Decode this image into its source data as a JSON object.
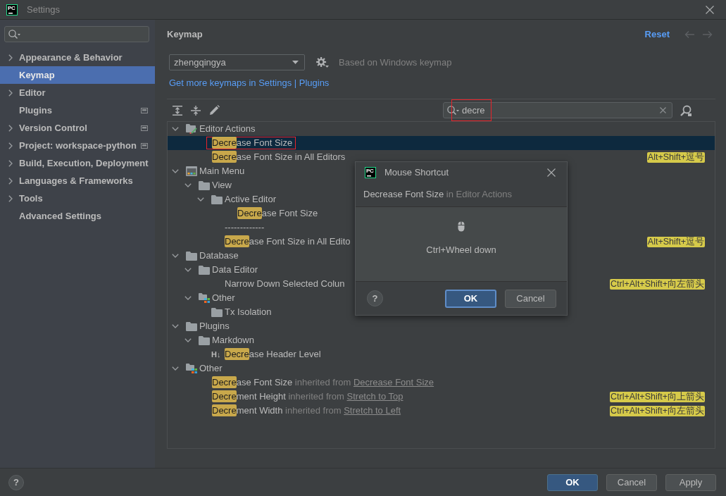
{
  "window": {
    "logo": "PC",
    "title": "Settings"
  },
  "sidebar": {
    "items": [
      {
        "label": "Appearance & Behavior",
        "expandable": true,
        "project_level": false,
        "selected": false
      },
      {
        "label": "Keymap",
        "expandable": false,
        "project_level": false,
        "selected": true
      },
      {
        "label": "Editor",
        "expandable": true,
        "project_level": false,
        "selected": false
      },
      {
        "label": "Plugins",
        "expandable": false,
        "project_level": true,
        "selected": false
      },
      {
        "label": "Version Control",
        "expandable": true,
        "project_level": true,
        "selected": false
      },
      {
        "label": "Project: workspace-python",
        "expandable": true,
        "project_level": true,
        "selected": false
      },
      {
        "label": "Build, Execution, Deployment",
        "expandable": true,
        "project_level": false,
        "selected": false
      },
      {
        "label": "Languages & Frameworks",
        "expandable": true,
        "project_level": false,
        "selected": false
      },
      {
        "label": "Tools",
        "expandable": true,
        "project_level": false,
        "selected": false
      },
      {
        "label": "Advanced Settings",
        "expandable": false,
        "project_level": false,
        "selected": false
      }
    ]
  },
  "keymap_page": {
    "title": "Keymap",
    "reset": "Reset",
    "nav": {
      "back_enabled": false,
      "forward_enabled": false
    },
    "keymap": {
      "value": "zhengqingya"
    },
    "based_on": "Based on Windows keymap",
    "link": "Get more keymaps in Settings | Plugins",
    "search": {
      "value": "decre",
      "annotated": true
    },
    "tree": [
      {
        "kind": "editor_group",
        "label": "Editor Actions",
        "expanded": true,
        "selected": false,
        "annotated": false,
        "children": [
          {
            "kind": "action",
            "match": "Decre",
            "text": "ase Font Size",
            "selected": true,
            "annotated": true
          },
          {
            "kind": "action",
            "match": "Decre",
            "text": "ase Font Size in All Editors",
            "shortcut": "Alt+Shift+逗号",
            "selected": false,
            "annotated": false
          }
        ]
      },
      {
        "kind": "menu_group",
        "label": "Main Menu",
        "expanded": true,
        "selected": false,
        "annotated": false,
        "children": [
          {
            "kind": "folder",
            "label": "View",
            "expanded": true,
            "selected": false,
            "annotated": false,
            "children": [
              {
                "kind": "folder",
                "label": "Active Editor",
                "expanded": true,
                "selected": false,
                "annotated": false,
                "children": [
                  {
                    "kind": "action",
                    "match": "Decre",
                    "text": "ase Font Size",
                    "selected": false,
                    "annotated": false
                  }
                ]
              },
              {
                "kind": "separator",
                "label": "-------------",
                "selected": false,
                "annotated": false
              },
              {
                "kind": "action",
                "match": "Decre",
                "text": "ase Font Size in All Edito",
                "shortcut": "Alt+Shift+逗号",
                "selected": false,
                "annotated": false
              }
            ]
          }
        ]
      },
      {
        "kind": "folder",
        "label": "Database",
        "expanded": true,
        "selected": false,
        "annotated": false,
        "children": [
          {
            "kind": "folder",
            "label": "Data Editor",
            "expanded": true,
            "selected": false,
            "annotated": false,
            "children": [
              {
                "kind": "action",
                "text": "Narrow Down Selected Colun",
                "shortcut": "Ctrl+Alt+Shift+向左箭头",
                "selected": false,
                "annotated": false
              }
            ]
          },
          {
            "kind": "mixed_group",
            "label": "Other",
            "expanded": true,
            "selected": false,
            "annotated": false,
            "children": [
              {
                "kind": "folder",
                "label": "Tx Isolation",
                "selected": false,
                "annotated": false
              }
            ]
          }
        ]
      },
      {
        "kind": "folder",
        "label": "Plugins",
        "expanded": true,
        "selected": false,
        "annotated": false,
        "children": [
          {
            "kind": "folder",
            "label": "Markdown",
            "expanded": true,
            "selected": false,
            "annotated": false,
            "children": [
              {
                "kind": "heading_action",
                "glyph": "H↓",
                "match": "Decre",
                "text": "ase Header Level",
                "selected": false,
                "annotated": false
              }
            ]
          }
        ]
      },
      {
        "kind": "mixed_group",
        "label": "Other",
        "expanded": true,
        "selected": false,
        "annotated": false,
        "children": [
          {
            "kind": "inherited",
            "match": "Decre",
            "text": "ase Font Size",
            "note": "inherited from",
            "link": "Decrease Font Size",
            "selected": false,
            "annotated": false
          },
          {
            "kind": "inherited",
            "match": "Decre",
            "text": "ment Height",
            "note": "inherited from",
            "link": "Stretch to Top",
            "shortcut": "Ctrl+Alt+Shift+向上箭头",
            "selected": false,
            "annotated": false
          },
          {
            "kind": "inherited",
            "match": "Decre",
            "text": "ment Width",
            "note": "inherited from",
            "link": "Stretch to Left",
            "shortcut": "Ctrl+Alt+Shift+向左箭头",
            "selected": false,
            "annotated": false
          }
        ]
      }
    ]
  },
  "dialog": {
    "logo": "PC",
    "title": "Mouse Shortcut",
    "action": "Decrease Font Size",
    "context": "in Editor Actions",
    "shortcut": "Ctrl+Wheel down",
    "help": "?",
    "buttons": [
      {
        "label": "OK",
        "primary": true
      },
      {
        "label": "Cancel",
        "primary": false
      }
    ]
  },
  "footer": {
    "help": "?",
    "buttons": [
      {
        "label": "OK",
        "primary": true
      },
      {
        "label": "Cancel",
        "primary": false
      },
      {
        "label": "Apply",
        "primary": false
      }
    ]
  }
}
